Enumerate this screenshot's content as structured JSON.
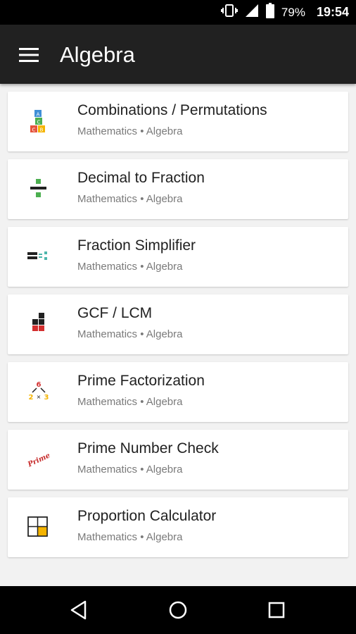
{
  "status_bar": {
    "battery_percent": "79%",
    "time": "19:54",
    "icons": [
      "vibrate-icon",
      "cell-signal-icon",
      "battery-icon"
    ]
  },
  "app_bar": {
    "title": "Algebra",
    "menu_icon": "hamburger-menu-icon"
  },
  "items": [
    {
      "name": "Combinations / Permutations",
      "subtitle": "Mathematics • Algebra",
      "icon": "abc-blocks-icon"
    },
    {
      "name": "Decimal to Fraction",
      "subtitle": "Mathematics • Algebra",
      "icon": "division-sign-icon"
    },
    {
      "name": "Fraction Simplifier",
      "subtitle": "Mathematics • Algebra",
      "icon": "fraction-equals-icon"
    },
    {
      "name": "GCF / LCM",
      "subtitle": "Mathematics • Algebra",
      "icon": "stacked-blocks-icon"
    },
    {
      "name": "Prime Factorization",
      "subtitle": "Mathematics • Algebra",
      "icon": "factor-tree-icon"
    },
    {
      "name": "Prime Number Check",
      "subtitle": "Mathematics • Algebra",
      "icon": "prime-stamp-icon"
    },
    {
      "name": "Proportion Calculator",
      "subtitle": "Mathematics • Algebra",
      "icon": "proportion-grid-icon"
    }
  ],
  "icon_text": {
    "factor_top": "6",
    "factor_left": "2",
    "factor_times": "×",
    "factor_right": "3",
    "prime_stamp": "Prime",
    "blocks": [
      "A",
      "C",
      "C",
      "B"
    ]
  },
  "nav_bar": {
    "icons": [
      "back-icon",
      "home-icon",
      "recents-icon"
    ]
  },
  "colors": {
    "status_bar": "#000000",
    "app_bar": "#212121",
    "background": "#f2f2f2",
    "card": "#ffffff",
    "title_text": "#212121",
    "subtitle_text": "#7a7a7a",
    "nav_bar": "#000000"
  }
}
